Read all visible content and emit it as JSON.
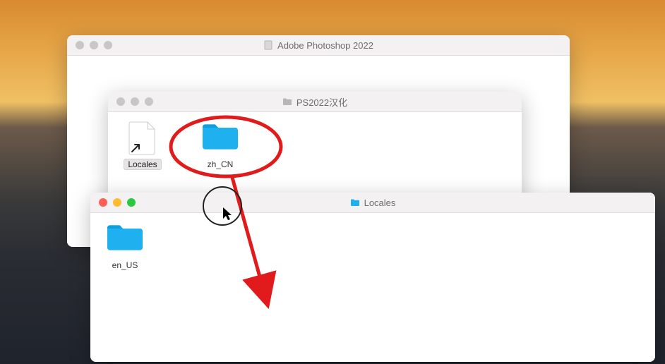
{
  "windows": {
    "back": {
      "title": "Adobe Photoshop 2022",
      "active": false,
      "icon": "app-icon"
    },
    "mid": {
      "title": "PS2022汉化",
      "active": false,
      "icon": "folder-icon",
      "items": [
        {
          "name": "Locales",
          "type": "alias",
          "selected": true
        },
        {
          "name": "zh_CN",
          "type": "folder",
          "selected": false
        }
      ]
    },
    "front": {
      "title": "Locales",
      "active": true,
      "icon": "folder-icon",
      "items": [
        {
          "name": "en_US",
          "type": "folder",
          "selected": false
        }
      ]
    }
  },
  "annotation": {
    "circle_target": "zh_CN",
    "arrow_from": "zh_CN",
    "arrow_to": "Locales window content",
    "color": "#e11b1b"
  }
}
